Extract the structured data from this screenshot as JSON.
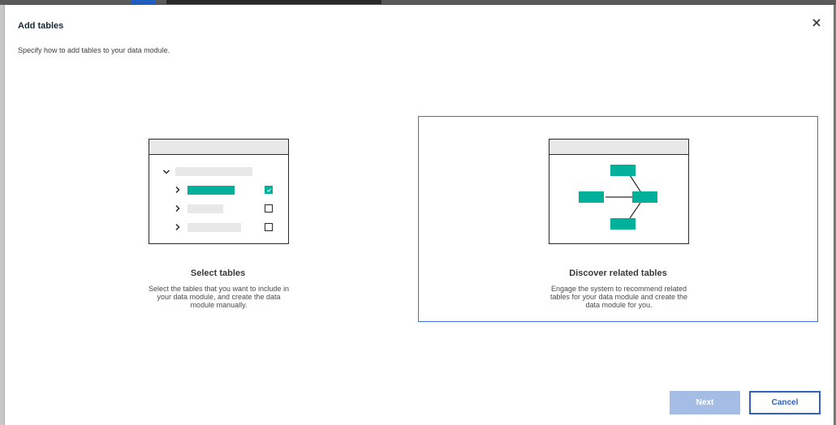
{
  "dialog": {
    "title": "Add tables",
    "subtitle": "Specify how to add tables to your data module.",
    "close_icon": "close-icon"
  },
  "options": [
    {
      "title": "Select tables",
      "description": "Select the tables that you want to include in your data module, and create the data module manually.",
      "selected": false
    },
    {
      "title": "Discover related tables",
      "description": "Engage the system to recommend related tables for your data module and create the data module for you.",
      "selected": true
    }
  ],
  "buttons": {
    "next_label": "Next",
    "cancel_label": "Cancel"
  },
  "colors": {
    "accent_teal": "#00b09b",
    "selection_border": "#3b73d9",
    "primary_disabled": "#a5bde4",
    "secondary_border": "#3062c1"
  }
}
